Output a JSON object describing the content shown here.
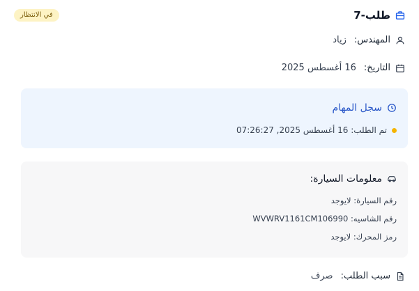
{
  "header": {
    "title": "طلب-7",
    "status_badge": "في الانتظار"
  },
  "engineer": {
    "label": "المهندس:",
    "value": "زياد"
  },
  "date": {
    "label": "التاريخ:",
    "value": "16 أغسطس 2025"
  },
  "task_log": {
    "title": "سجل المهام",
    "entries": [
      {
        "text": "تم الطلب: 16 أغسطس 2025, 07:26:27",
        "status_color": "#f5b400"
      }
    ]
  },
  "car_info": {
    "title": "معلومات السيارة:",
    "plate": "رقم السيارة: لايوجد",
    "chassis": "رقم الشاسيه: WVWRV1161CM106990",
    "engine": "رمز المحرك: لايوجد"
  },
  "reason": {
    "label": "سبب الطلب:",
    "value": "صرف"
  },
  "colors": {
    "accent": "#2856c8",
    "badge_bg": "#fdf3c4",
    "log_bg": "#eef5fe",
    "car_bg": "#f7f7f8"
  },
  "icons": {
    "title": "briefcase-icon",
    "engineer": "user-icon",
    "date": "calendar-icon",
    "task_log": "clock-icon",
    "car_info": "car-icon",
    "reason": "document-icon"
  }
}
